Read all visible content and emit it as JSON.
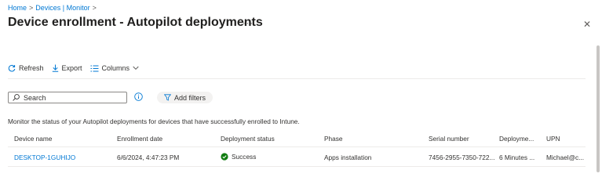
{
  "breadcrumb": {
    "items": [
      "Home",
      "Devices | Monitor"
    ],
    "separator": ">"
  },
  "page": {
    "title": "Device enrollment - Autopilot deployments",
    "more": "···",
    "close": "✕"
  },
  "toolbar": {
    "refresh": "Refresh",
    "export": "Export",
    "columns": "Columns"
  },
  "filters": {
    "search_placeholder": "Search",
    "add_filters": "Add filters"
  },
  "description": "Monitor the status of your Autopilot deployments for devices that have successfully enrolled to Intune.",
  "table": {
    "columns": [
      "Device name",
      "Enrollment date",
      "Deployment status",
      "Phase",
      "Serial number",
      "Deployme...",
      "UPN"
    ],
    "rows": [
      {
        "device_name": "DESKTOP-1GUHIJO",
        "enrollment_date": "6/6/2024, 4:47:23 PM",
        "deployment_status": "Success",
        "phase": "Apps installation",
        "serial_number": "7456-2955-7350-722...",
        "deployment_time": "6 Minutes ...",
        "upn": "Michael@c..."
      }
    ]
  },
  "colors": {
    "accent": "#0078d4",
    "success": "#107c10"
  },
  "icons": [
    "refresh-icon",
    "download-icon",
    "columns-icon",
    "chevron-down-icon",
    "search-icon",
    "info-icon",
    "filter-icon",
    "success-icon",
    "close-icon"
  ]
}
